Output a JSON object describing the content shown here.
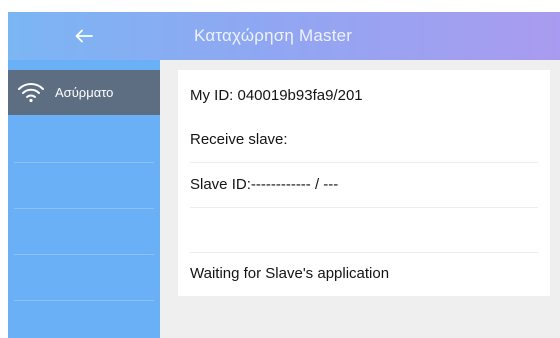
{
  "header": {
    "back_icon": "arrow-left-icon",
    "title": "Καταχώρηση Master",
    "colors": {
      "gradient_start": "#7bb6f3",
      "gradient_end": "#a99bef"
    }
  },
  "sidebar": {
    "items": [
      {
        "label": "Ασύρματο",
        "icon": "wifi-icon",
        "active": true
      }
    ],
    "colors": {
      "background": "#69b0f7",
      "active": "#5d6e83"
    }
  },
  "main": {
    "rows": [
      {
        "text": "My ID: 040019b93fa9/201"
      },
      {
        "text": "Receive slave:"
      },
      {
        "text": "Slave ID:------------ / ---"
      },
      {
        "text": ""
      },
      {
        "text": "Waiting for Slave's application"
      }
    ],
    "colors": {
      "background": "#efefef",
      "card": "#ffffff"
    }
  }
}
